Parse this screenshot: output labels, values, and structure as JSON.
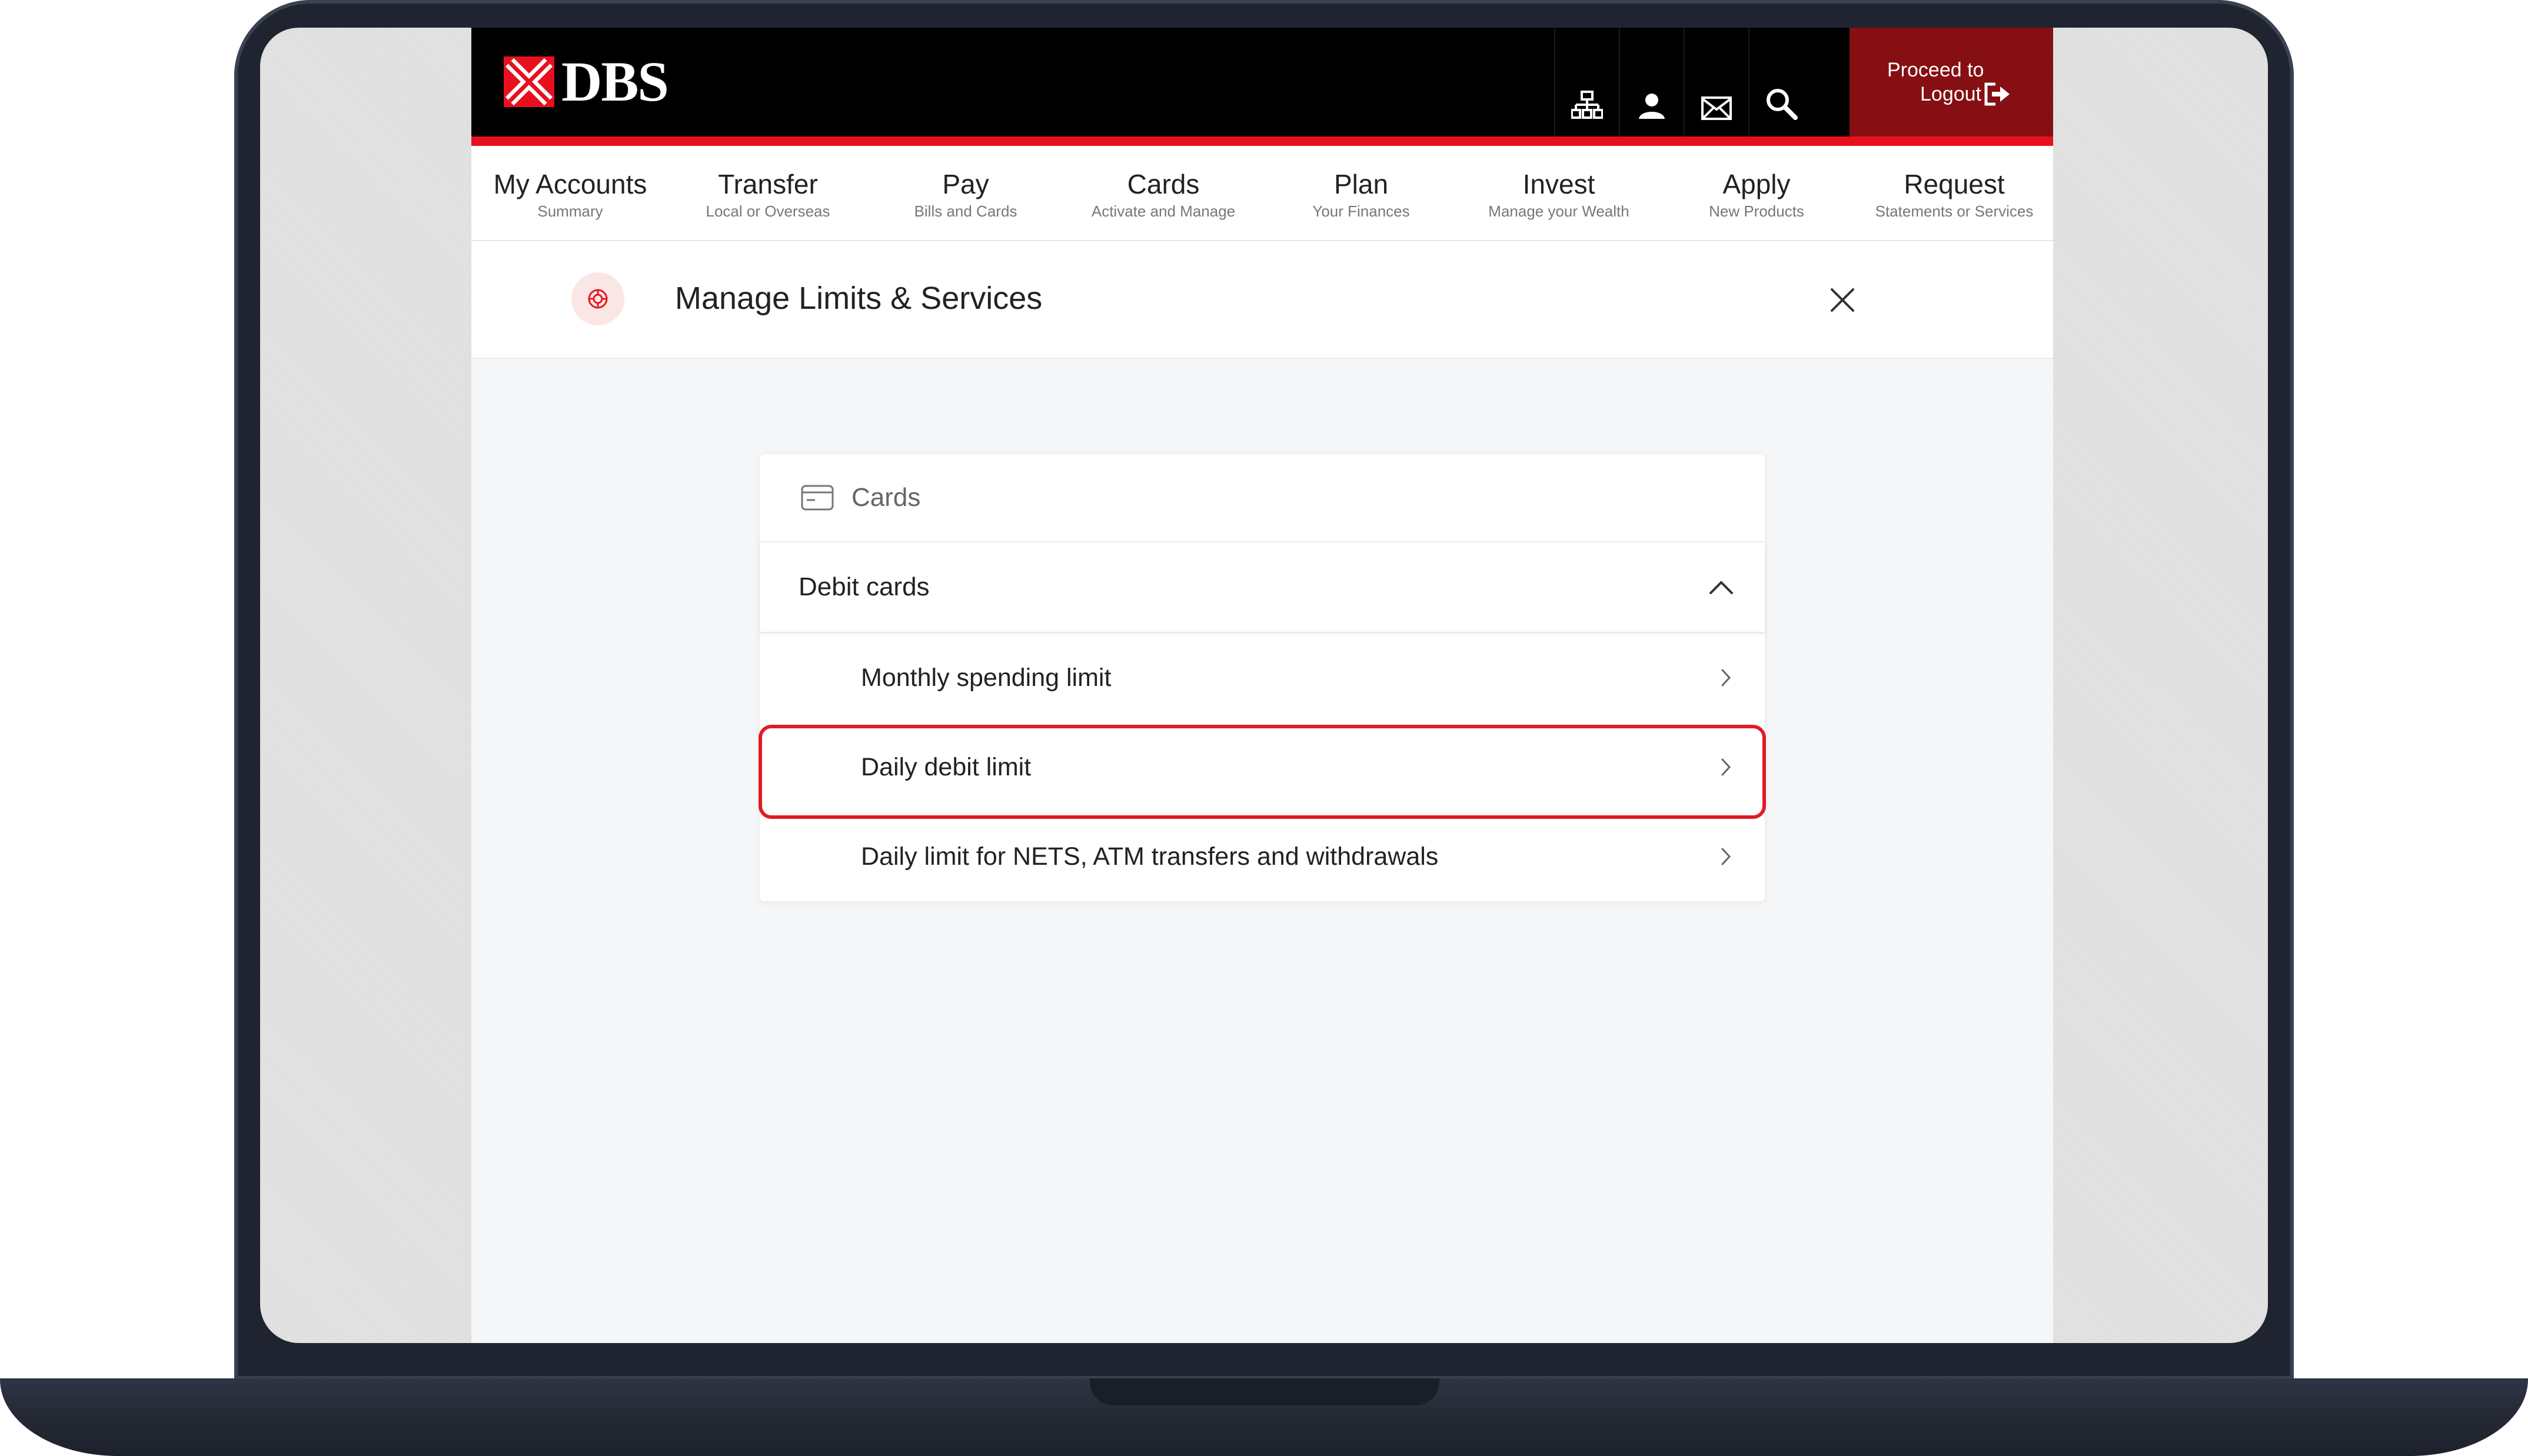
{
  "brand": {
    "name": "DBS",
    "accent": "#e8101f",
    "dark_red": "#850f12"
  },
  "header": {
    "icons": [
      "sitemap-icon",
      "profile-icon",
      "mail-icon",
      "search-icon"
    ],
    "logout_line1": "Proceed to",
    "logout_line2": "Logout"
  },
  "nav": [
    {
      "label": "My Accounts",
      "sub": "Summary"
    },
    {
      "label": "Transfer",
      "sub": "Local or Overseas"
    },
    {
      "label": "Pay",
      "sub": "Bills and Cards"
    },
    {
      "label": "Cards",
      "sub": "Activate and Manage"
    },
    {
      "label": "Plan",
      "sub": "Your Finances"
    },
    {
      "label": "Invest",
      "sub": "Manage your Wealth"
    },
    {
      "label": "Apply",
      "sub": "New Products"
    },
    {
      "label": "Request",
      "sub": "Statements or Services"
    }
  ],
  "section": {
    "title": "Manage Limits & Services",
    "icon": "limits-dial-icon"
  },
  "panel": {
    "heading": "Cards",
    "heading_icon": "card-icon",
    "accordion": {
      "label": "Debit cards",
      "expanded": true,
      "items": [
        {
          "label": "Monthly spending limit",
          "highlighted": false
        },
        {
          "label": "Daily debit limit",
          "highlighted": true
        },
        {
          "label": "Daily limit for NETS, ATM transfers and withdrawals",
          "highlighted": false
        }
      ]
    }
  },
  "highlight_color": "#e21a22"
}
